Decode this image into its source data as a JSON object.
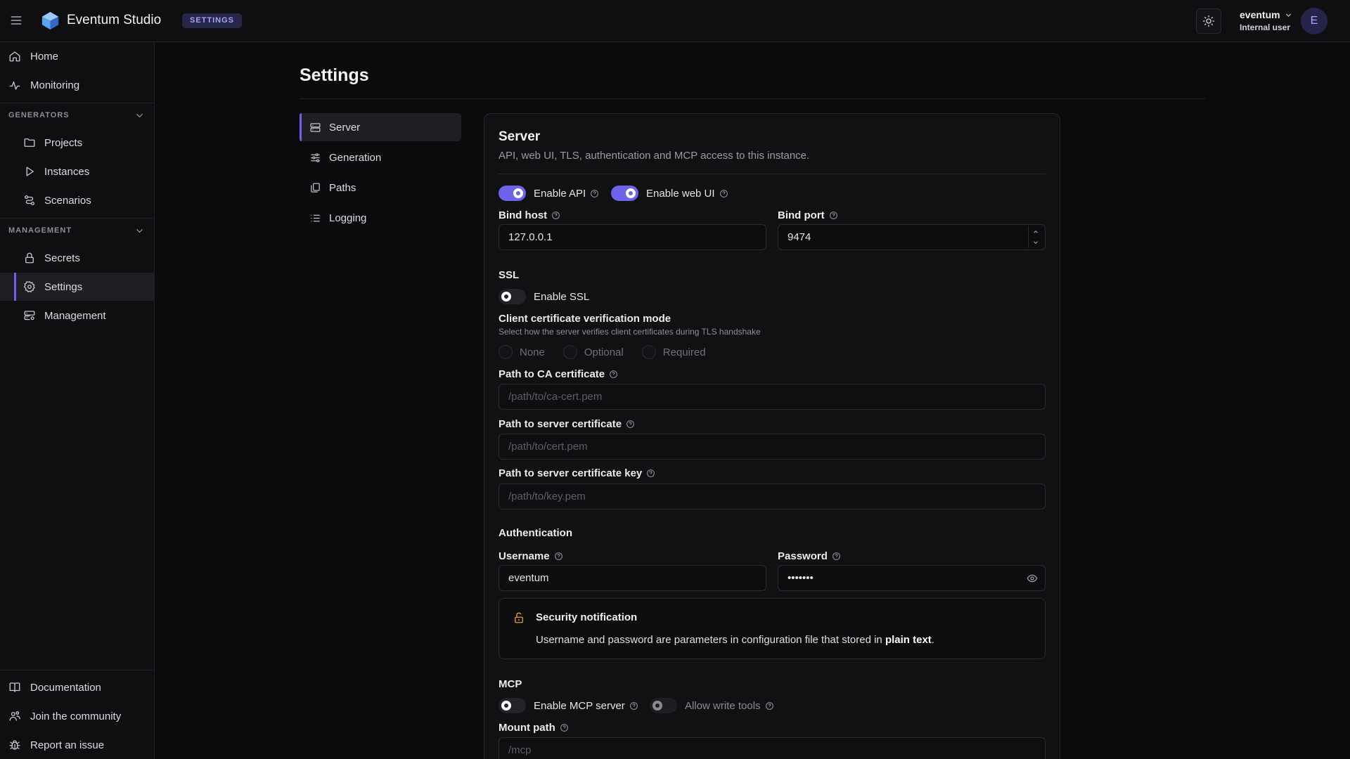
{
  "app": {
    "title": "Eventum Studio",
    "page_badge": "SETTINGS"
  },
  "user": {
    "name": "eventum",
    "role": "Internal user",
    "avatar_initial": "E"
  },
  "sidebar": {
    "top_items": [
      {
        "label": "Home",
        "icon": "home-icon"
      },
      {
        "label": "Monitoring",
        "icon": "activity-icon"
      }
    ],
    "sections": [
      {
        "title": "GENERATORS",
        "items": [
          {
            "label": "Projects",
            "icon": "folder-icon"
          },
          {
            "label": "Instances",
            "icon": "play-icon"
          },
          {
            "label": "Scenarios",
            "icon": "scenario-icon"
          }
        ]
      },
      {
        "title": "MANAGEMENT",
        "items": [
          {
            "label": "Secrets",
            "icon": "lock-icon"
          },
          {
            "label": "Settings",
            "icon": "gear-icon",
            "active": true
          },
          {
            "label": "Management",
            "icon": "server-gear-icon"
          }
        ]
      }
    ],
    "bottom_items": [
      {
        "label": "Documentation",
        "icon": "book-icon"
      },
      {
        "label": "Join the community",
        "icon": "users-icon"
      },
      {
        "label": "Report an issue",
        "icon": "bug-icon"
      }
    ]
  },
  "main": {
    "title": "Settings",
    "subnav": [
      {
        "label": "Server",
        "icon": "server-icon",
        "active": true
      },
      {
        "label": "Generation",
        "icon": "sliders-icon"
      },
      {
        "label": "Paths",
        "icon": "files-icon"
      },
      {
        "label": "Logging",
        "icon": "list-icon"
      }
    ]
  },
  "server": {
    "title": "Server",
    "description": "API, web UI, TLS, authentication and MCP access to this instance.",
    "enable_api": {
      "label": "Enable API",
      "checked": true
    },
    "enable_web_ui": {
      "label": "Enable web UI",
      "checked": true
    },
    "bind_host": {
      "label": "Bind host",
      "value": "127.0.0.1"
    },
    "bind_port": {
      "label": "Bind port",
      "value": "9474"
    },
    "ssl": {
      "heading": "SSL",
      "enable_label": "Enable SSL",
      "enabled": false,
      "verify_mode_label": "Client certificate verification mode",
      "verify_mode_hint": "Select how the server verifies client certificates during TLS handshake",
      "verify_options": [
        "None",
        "Optional",
        "Required"
      ],
      "ca_label": "Path to CA certificate",
      "ca_placeholder": "/path/to/ca-cert.pem",
      "cert_label": "Path to server certificate",
      "cert_placeholder": "/path/to/cert.pem",
      "key_label": "Path to server certificate key",
      "key_placeholder": "/path/to/key.pem"
    },
    "auth": {
      "heading": "Authentication",
      "username_label": "Username",
      "username_value": "eventum",
      "password_label": "Password",
      "password_value": "•••••••",
      "notice_title": "Security notification",
      "notice_text": "Username and password are parameters in configuration file that stored in ",
      "notice_emphasis": "plain text",
      "notice_end": "."
    },
    "mcp": {
      "heading": "MCP",
      "enable_label": "Enable MCP server",
      "enabled": false,
      "write_tools_label": "Allow write tools",
      "write_tools_enabled": false,
      "mount_label": "Mount path",
      "mount_placeholder": "/mcp"
    }
  },
  "colors": {
    "accent": "#6c63e8",
    "background": "#0b0b0d",
    "warning": "#d4a32a"
  }
}
